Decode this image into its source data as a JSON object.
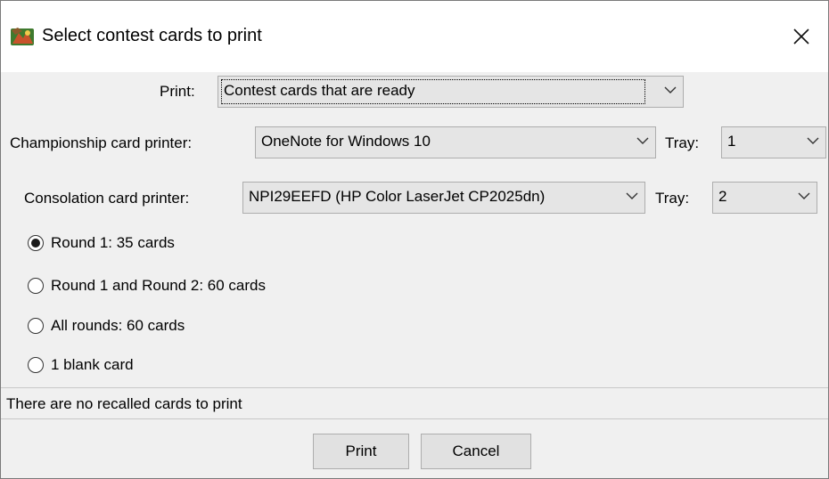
{
  "window": {
    "title": "Select contest cards to print",
    "close_icon": "close-icon",
    "app_icon": "app-logo-icon"
  },
  "print_row": {
    "label": "Print:",
    "value": "Contest cards that are ready"
  },
  "championship": {
    "label": "Championship card printer:",
    "printer": "OneNote for Windows 10",
    "tray_label": "Tray:",
    "tray_value": "1"
  },
  "consolation": {
    "label": "Consolation card printer:",
    "printer": "NPI29EEFD (HP Color LaserJet CP2025dn)",
    "tray_label": "Tray:",
    "tray_value": "2"
  },
  "rounds": [
    {
      "label": "Round 1: 35 cards",
      "checked": true
    },
    {
      "label": "Round 1 and Round 2: 60 cards",
      "checked": false
    },
    {
      "label": "All rounds: 60 cards",
      "checked": false
    },
    {
      "label": "1 blank card",
      "checked": false
    }
  ],
  "status": "There are no recalled cards to print",
  "buttons": {
    "print": "Print",
    "cancel": "Cancel"
  }
}
